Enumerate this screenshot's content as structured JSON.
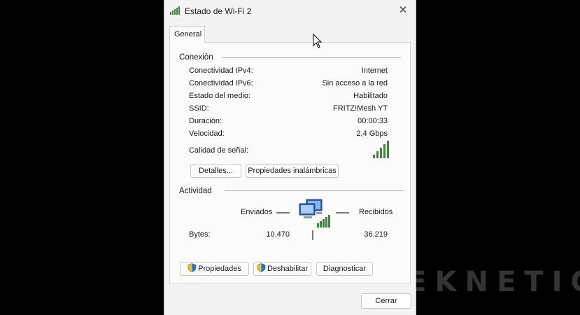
{
  "window": {
    "title": "Estado de Wi-Fi 2",
    "close_glyph": "✕"
  },
  "tabs": [
    {
      "label": "General"
    }
  ],
  "connection": {
    "title": "Conexión",
    "rows": [
      {
        "label": "Conectividad IPv4:",
        "value": "Internet"
      },
      {
        "label": "Conectividad IPv6:",
        "value": "Sin acceso a la red"
      },
      {
        "label": "Estado del medio:",
        "value": "Habilitado"
      },
      {
        "label": "SSID:",
        "value": "FRITZ!Mesh YT"
      },
      {
        "label": "Duración:",
        "value": "00:00:33"
      },
      {
        "label": "Velocidad:",
        "value": "2,4 Gbps"
      }
    ],
    "signal_label": "Calidad de señal:",
    "signal_level": 5,
    "signal_max": 5,
    "details_button": "Detalles...",
    "wireless_props_button": "Propiedades inalámbricas"
  },
  "activity": {
    "title": "Actividad",
    "sent_label": "Enviados",
    "received_label": "Recibidos",
    "bytes_label": "Bytes:",
    "bytes_sent": "10.470",
    "bytes_received": "36.219"
  },
  "buttons": {
    "properties": "Propiedades",
    "disable": "Deshabilitar",
    "diagnose": "Diagnosticar",
    "close": "Cerrar"
  },
  "watermark": "GEEKNETIC",
  "colors": {
    "signal": "#3a8a3a",
    "accent": "#0067c0",
    "background": "#000000"
  }
}
